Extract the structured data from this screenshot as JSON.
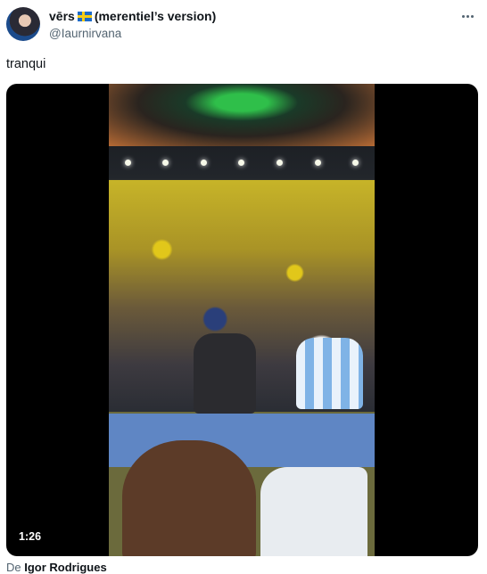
{
  "tweet": {
    "display_name": "vērs",
    "name_suffix": "(merentiel’s version)",
    "flag_icon": "sweden-flag-icon",
    "handle": "@Iaurnirvana",
    "text": "tranqui",
    "more_icon": "more-options-icon"
  },
  "video": {
    "duration": "1:26",
    "description_visible": "stadium crowd video"
  },
  "credit": {
    "prefix": "De",
    "author": "Igor Rodrigues"
  },
  "colors": {
    "text_primary": "#0f1419",
    "text_secondary": "#536471",
    "video_bg": "#000000"
  }
}
